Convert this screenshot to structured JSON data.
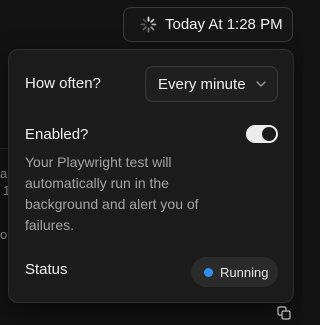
{
  "trigger": {
    "label": "Today At 1:28 PM",
    "icon": "spinner-icon"
  },
  "popover": {
    "frequency": {
      "label": "How often?",
      "selected": "Every minute",
      "icon": "chevron-down-icon"
    },
    "enabled": {
      "label": "Enabled?",
      "on": true,
      "description": "Your Playwright test will automatically run in the background and alert you of failures."
    },
    "status": {
      "label": "Status",
      "value": "Running",
      "dot_color": "#2f8ff2"
    }
  },
  "footer": {
    "icon": "copy-icon"
  },
  "colors": {
    "background": "#121212",
    "popover": "#1b1b1b",
    "accent": "#2f8ff2",
    "toggle_on": "#ececec"
  }
}
